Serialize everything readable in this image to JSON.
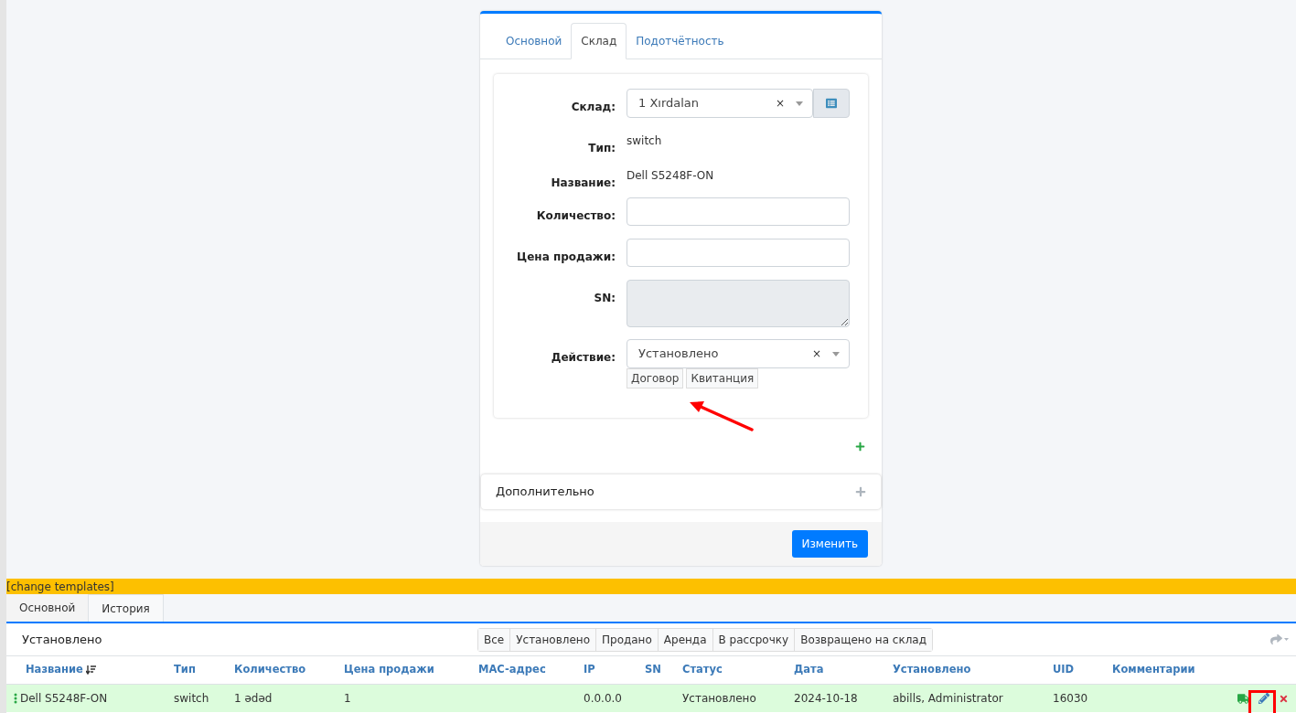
{
  "form": {
    "tabs": [
      {
        "label": "Основной",
        "selected": false
      },
      {
        "label": "Склад",
        "selected": true
      },
      {
        "label": "Подотчётность",
        "selected": false
      }
    ],
    "fields": [
      {
        "kind": "select",
        "label": "Склад:",
        "value": "1 Xırdalan",
        "clear": "×"
      },
      {
        "kind": "static",
        "label": "Тип:",
        "value": "switch"
      },
      {
        "kind": "static",
        "label": "Название:",
        "value": "Dell S5248F-ON"
      },
      {
        "kind": "input",
        "label": "Количество:"
      },
      {
        "kind": "input",
        "label": "Цена продажи:"
      },
      {
        "kind": "textarea",
        "label": "SN:",
        "disabled": true
      },
      {
        "kind": "select",
        "label": "Действие:",
        "value": "Установлено",
        "clear": "×"
      }
    ],
    "doc_buttons": [
      "Договор",
      "Квитанция"
    ],
    "extra_section": "Дополнительно",
    "submit": "Изменить"
  },
  "templates_link": "[change templates]",
  "bottom_tabs": [
    {
      "label": "Основной",
      "selected": false
    },
    {
      "label": "История",
      "selected": true
    }
  ],
  "panel": {
    "title": "Установлено",
    "filters": [
      "Все",
      "Установлено",
      "Продано",
      "Аренда",
      "В рассрочку",
      "Возвращено на склад"
    ],
    "columns": [
      {
        "label": "Название",
        "sorted": true
      },
      {
        "label": "Тип",
        "sorted": false
      },
      {
        "label": "Количество",
        "sorted": false
      },
      {
        "label": "Цена продажи",
        "sorted": false
      },
      {
        "label": "MAC-адрес",
        "sorted": false
      },
      {
        "label": "IP",
        "sorted": false
      },
      {
        "label": "SN",
        "sorted": false
      },
      {
        "label": "Статус",
        "sorted": false
      },
      {
        "label": "Дата",
        "sorted": false
      },
      {
        "label": "Установлено",
        "sorted": false
      },
      {
        "label": "UID",
        "sorted": false
      },
      {
        "label": "Комментарии",
        "sorted": false
      }
    ],
    "rows": [
      {
        "cells": [
          "Dell S5248F-ON",
          "switch",
          "1 ədəd",
          "1",
          "",
          "0.0.0.0",
          "",
          "Установлено",
          "2024-10-18",
          "abills, Administrator",
          "16030",
          ""
        ]
      }
    ]
  }
}
